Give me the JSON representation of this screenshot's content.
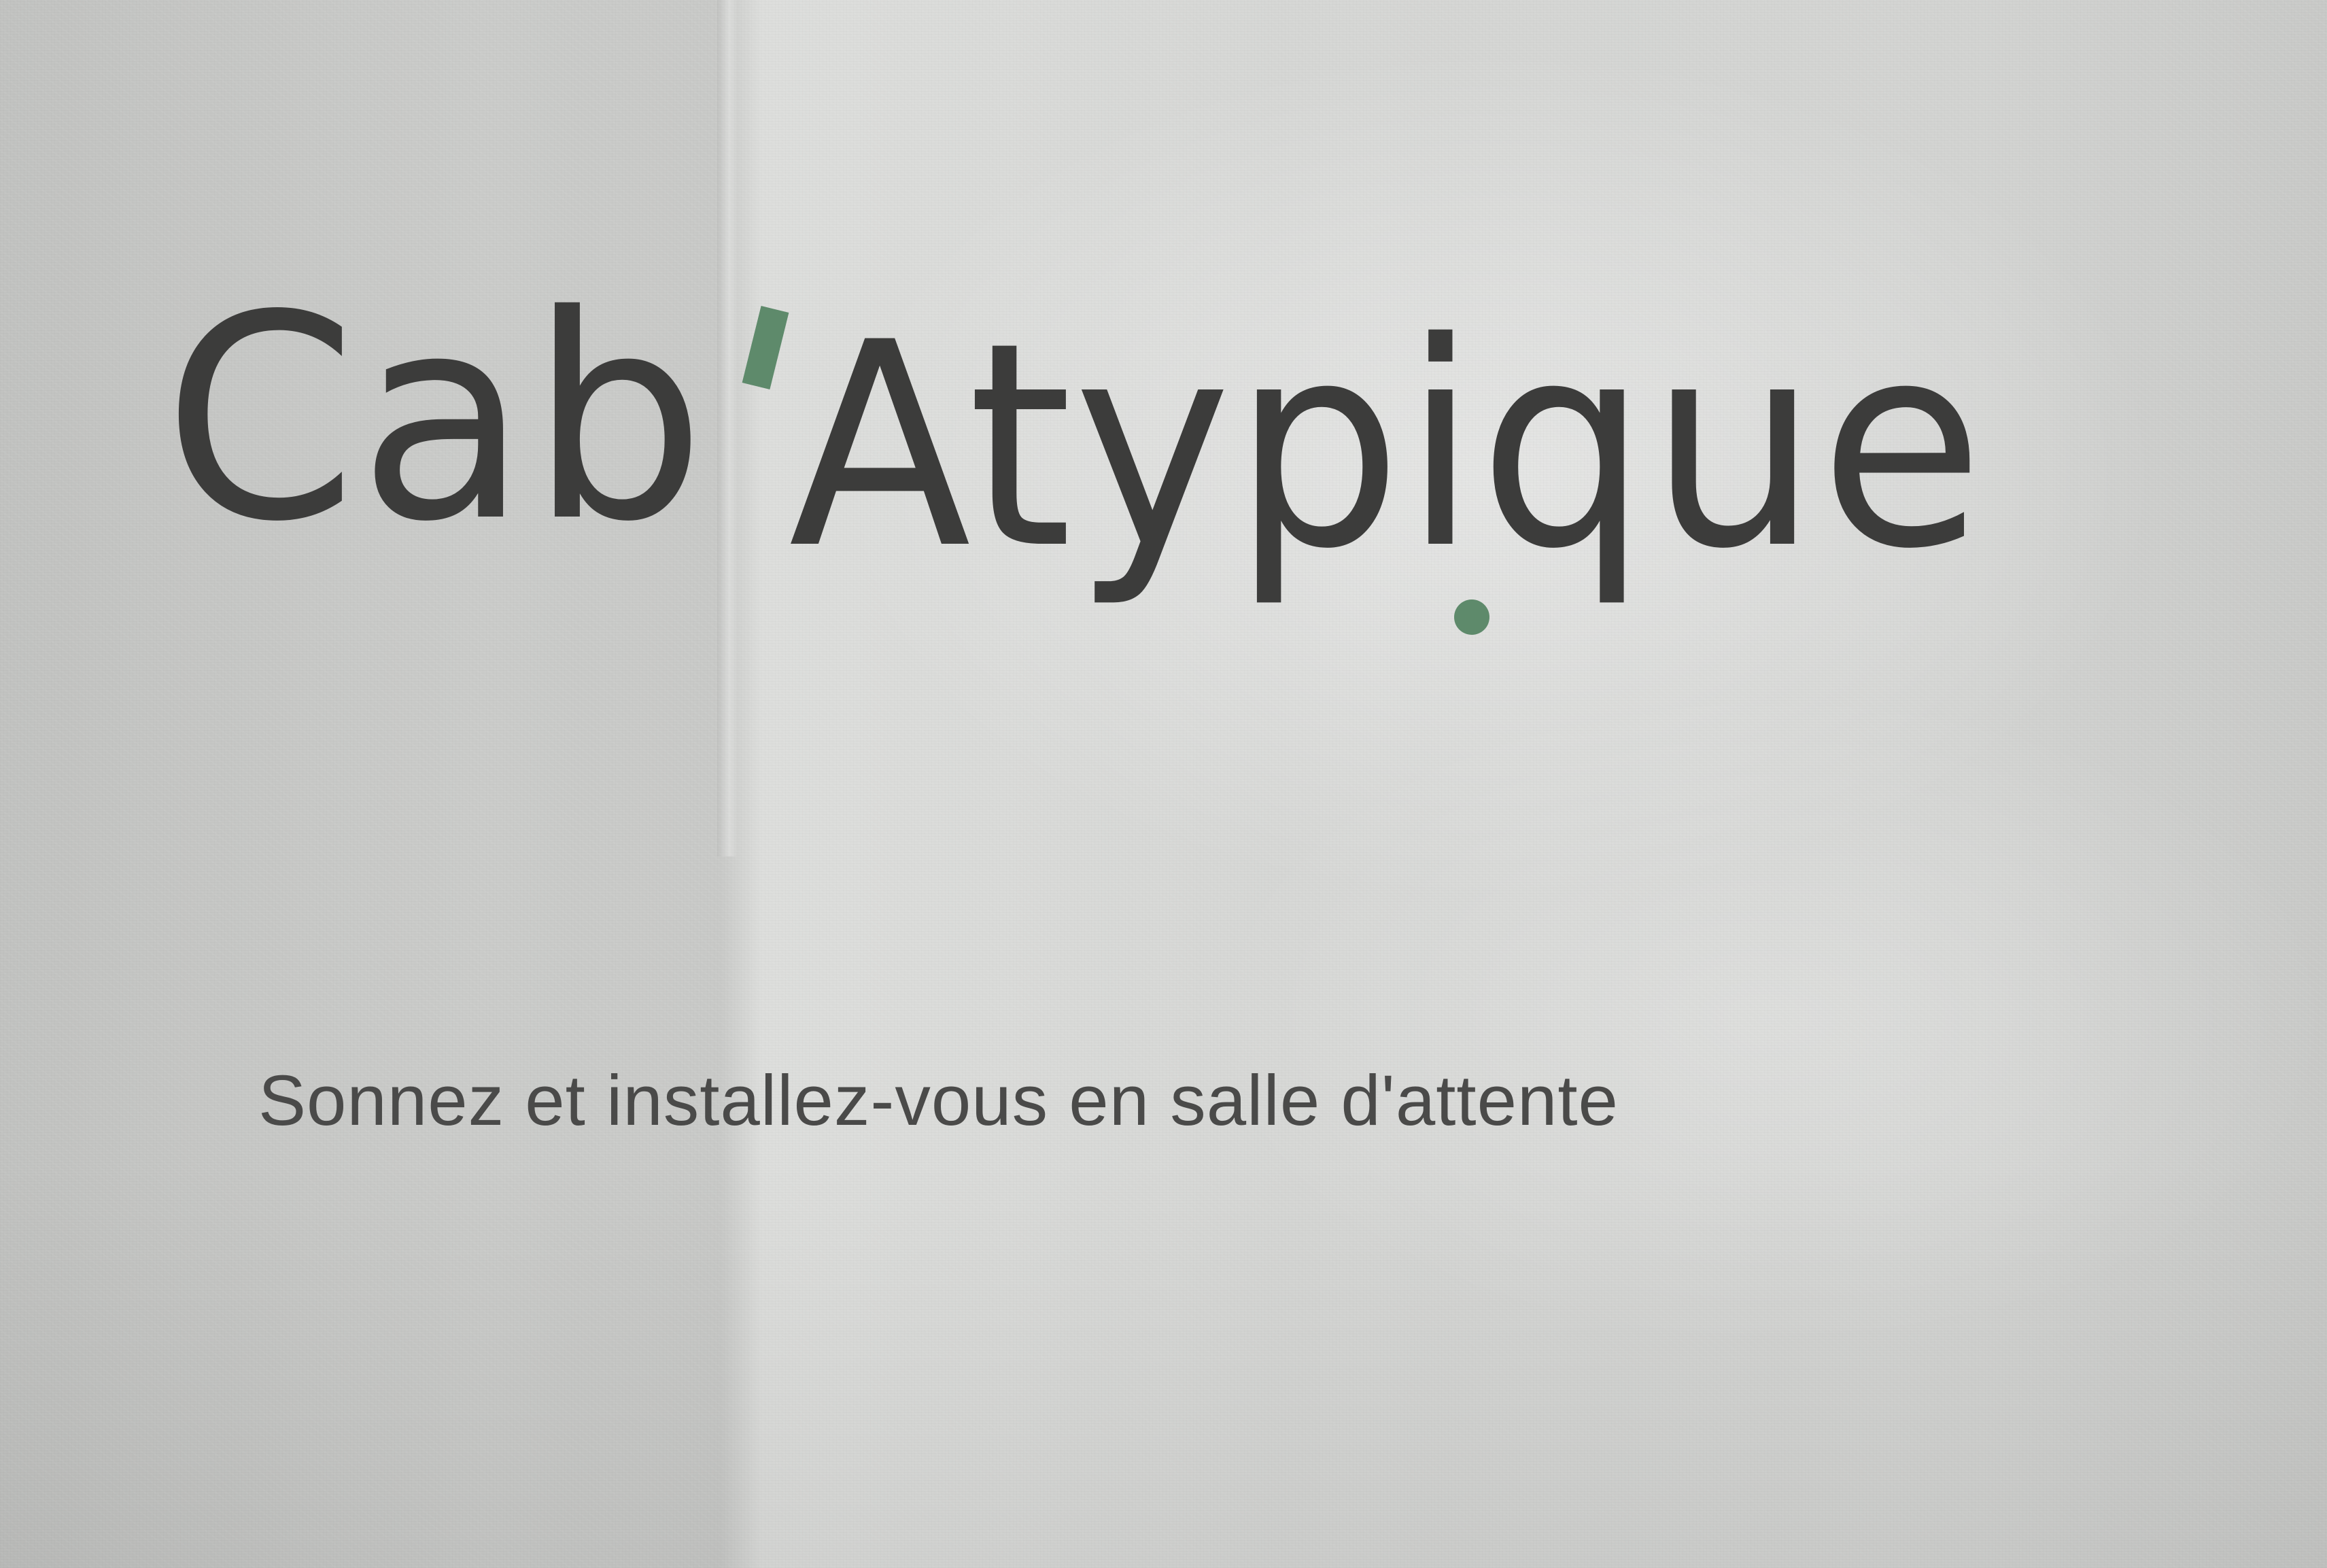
{
  "logo": {
    "wordmark_part1": "Cab",
    "wordmark_part2": "Atypique",
    "wordmark_full": "Cab'Atypique",
    "text_color": "#3c3c3b",
    "accent_color": "#5e8a6b"
  },
  "tagline": "Sonnez et installez-vous en salle d'attente",
  "colors": {
    "paper": "#d3d4d2",
    "tagline_text": "#4a4a49"
  }
}
